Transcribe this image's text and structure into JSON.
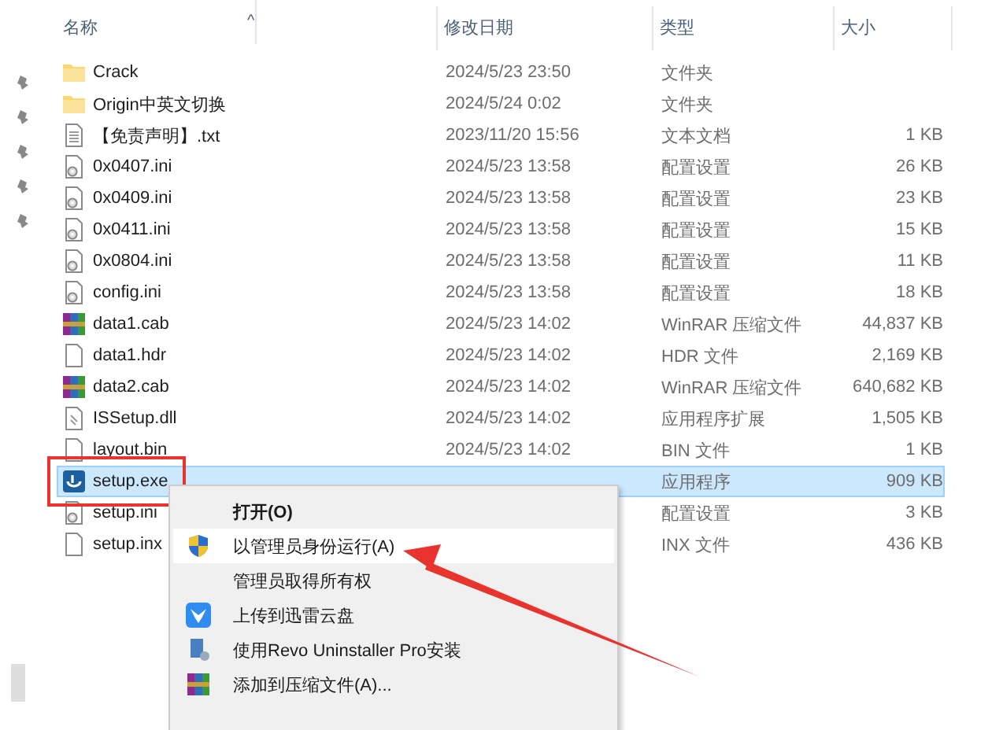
{
  "sort_indicator": "^",
  "columns": [
    "名称",
    "修改日期",
    "类型",
    "大小"
  ],
  "pins": [
    {
      "kind": "pin"
    },
    {
      "kind": "pin"
    },
    {
      "kind": "pin"
    },
    {
      "kind": "pin"
    },
    {
      "kind": "pin"
    }
  ],
  "rows": [
    {
      "kind": "folder",
      "name": "Crack",
      "date": "2024/5/23 23:50",
      "type": "文件夹",
      "selected": false
    },
    {
      "kind": "folder",
      "name": "Origin中英文切换",
      "date": "2024/5/24 0:02",
      "type": "文件夹",
      "selected": false
    },
    {
      "kind": "text",
      "name": "【免责声明】.txt",
      "date": "2023/11/20 15:56",
      "type": "文本文档",
      "size": "1 KB",
      "selected": false
    },
    {
      "kind": "config",
      "name": "0x0407.ini",
      "date": "2024/5/23 13:58",
      "type": "配置设置",
      "size": "26 KB",
      "selected": false
    },
    {
      "kind": "config",
      "name": "0x0409.ini",
      "date": "2024/5/23 13:58",
      "type": "配置设置",
      "size": "23 KB",
      "selected": false
    },
    {
      "kind": "config",
      "name": "0x0411.ini",
      "date": "2024/5/23 13:58",
      "type": "配置设置",
      "size": "15 KB",
      "selected": false
    },
    {
      "kind": "config",
      "name": "0x0804.ini",
      "date": "2024/5/23 13:58",
      "type": "配置设置",
      "size": "11 KB",
      "selected": false
    },
    {
      "kind": "config",
      "name": "config.ini",
      "date": "2024/5/23 13:58",
      "type": "配置设置",
      "size": "18 KB",
      "selected": false
    },
    {
      "kind": "archive",
      "name": "data1.cab",
      "date": "2024/5/23 14:02",
      "type": "WinRAR 压缩文件",
      "size": "44,837 KB",
      "selected": false
    },
    {
      "kind": "file",
      "name": "data1.hdr",
      "date": "2024/5/23 14:02",
      "type": "HDR 文件",
      "size": "2,169 KB",
      "selected": false
    },
    {
      "kind": "archive",
      "name": "data2.cab",
      "date": "2024/5/23 14:02",
      "type": "WinRAR 压缩文件",
      "size": "640,682 KB",
      "selected": false
    },
    {
      "kind": "library",
      "name": "ISSetup.dll",
      "date": "2024/5/23 14:02",
      "type": "应用程序扩展",
      "size": "1,505 KB",
      "selected": false
    },
    {
      "kind": "file",
      "name": "layout.bin",
      "date": "2024/5/23 14:02",
      "type": "BIN 文件",
      "size": "1 KB",
      "selected": false
    },
    {
      "kind": "app",
      "name": "setup.exe",
      "type": "应用程序",
      "size": "909 KB",
      "selected": true
    },
    {
      "kind": "config",
      "name": "setup.ini",
      "type": "配置设置",
      "size": "3 KB",
      "selected": false
    },
    {
      "kind": "file",
      "name": "setup.inx",
      "type": "INX 文件",
      "size": "436 KB",
      "selected": false
    }
  ],
  "context_menu": {
    "items": [
      {
        "kind": "plain",
        "label": "打开(O)",
        "default": true,
        "selected": false
      },
      {
        "kind": "shield",
        "label": "以管理员身份运行(A)",
        "default": false,
        "selected": true
      },
      {
        "kind": "plain",
        "label": "管理员取得所有权",
        "default": false,
        "selected": false
      },
      {
        "kind": "cloud",
        "label": "上传到迅雷云盘",
        "default": false,
        "selected": false
      },
      {
        "kind": "installer",
        "label": "使用Revo Uninstaller Pro安装",
        "default": false,
        "selected": false
      },
      {
        "kind": "archive",
        "label": "添加到压缩文件(A)...",
        "default": false,
        "selected": false
      }
    ]
  }
}
